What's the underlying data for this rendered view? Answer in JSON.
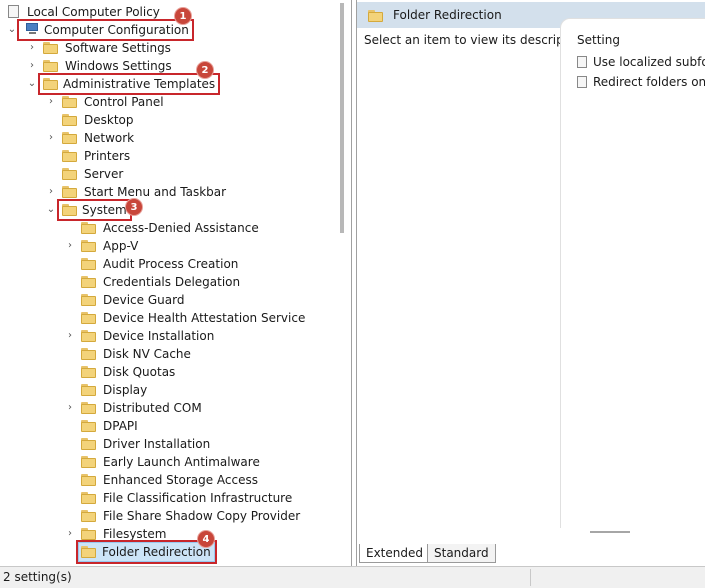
{
  "tree": {
    "root": "Local Computer Policy",
    "computer_config": "Computer Configuration",
    "software_settings": "Software Settings",
    "windows_settings": "Windows Settings",
    "admin_templates": "Administrative Templates",
    "control_panel": "Control Panel",
    "desktop": "Desktop",
    "network": "Network",
    "printers": "Printers",
    "server": "Server",
    "start_menu": "Start Menu and Taskbar",
    "system": "System",
    "system_children": [
      "Access-Denied Assistance",
      "App-V",
      "Audit Process Creation",
      "Credentials Delegation",
      "Device Guard",
      "Device Health Attestation Service",
      "Device Installation",
      "Disk NV Cache",
      "Disk Quotas",
      "Display",
      "Distributed COM",
      "DPAPI",
      "Driver Installation",
      "Early Launch Antimalware",
      "Enhanced Storage Access",
      "File Classification Infrastructure",
      "File Share Shadow Copy Provider",
      "Filesystem",
      "Folder Redirection"
    ]
  },
  "badges": [
    "1",
    "2",
    "3",
    "4"
  ],
  "right": {
    "header_title": "Folder Redirection",
    "description": "Select an item to view its description.",
    "column_header": "Setting",
    "settings": [
      "Use localized subfold",
      "Redirect folders on pr"
    ]
  },
  "tabs": {
    "extended": "Extended",
    "standard": "Standard"
  },
  "status": {
    "text": "2 setting(s)"
  },
  "colors": {
    "highlight": "#c8262b",
    "badge": "#c8463a",
    "header": "#d3e0ec"
  }
}
